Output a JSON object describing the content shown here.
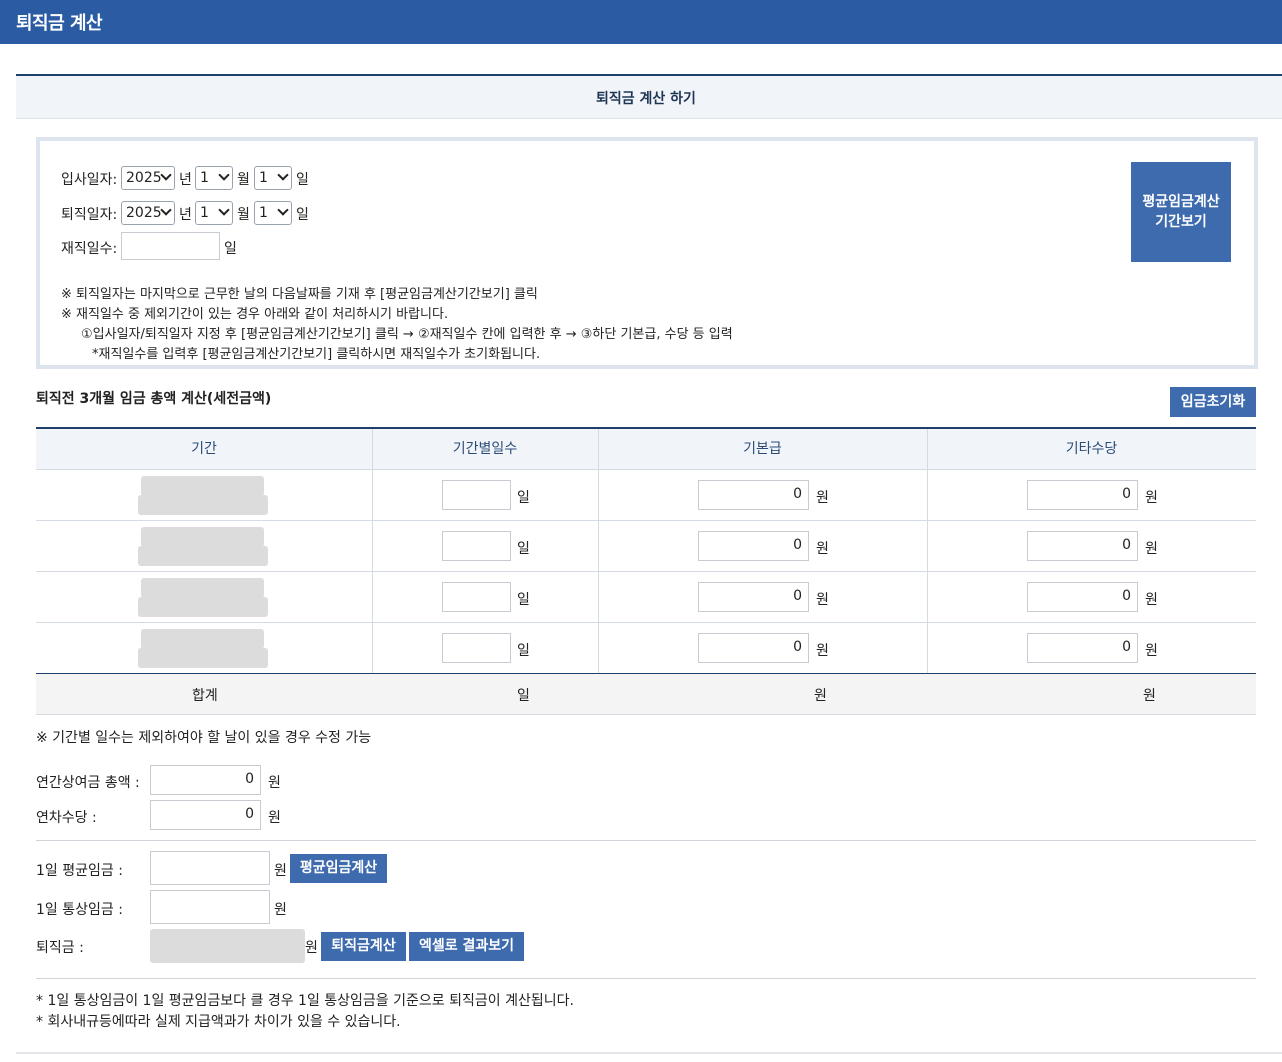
{
  "app_title": "퇴직금 계산",
  "section_title": "퇴직금 계산 하기",
  "form": {
    "entry_label": "입사일자:",
    "exit_label": "퇴직일자:",
    "days_label": "재직일수:",
    "year_value": "2025",
    "month_value": "1",
    "day_value": "1",
    "year_unit": "년",
    "month_unit": "월",
    "day_unit": "일",
    "days_unit": "일",
    "avg_period_button": "평균임금계산 기간보기",
    "notes": [
      "※ 퇴직일자는 마지막으로 근무한 날의 다음날짜를 기재 후 [평균임금계산기간보기] 클릭",
      "※ 재직일수 중 제외기간이 있는 경우 아래와 같이 처리하시기 바랍니다.",
      "①입사일자/퇴직일자 지정 후 [평균임금계산기간보기] 클릭 → ②재직일수 칸에 입력한 후 → ③하단 기본급, 수당 등 입력",
      "*재직일수를 입력후 [평균임금계산기간보기] 클릭하시면 재직일수가 초기화됩니다."
    ]
  },
  "wage_section": {
    "title": "퇴직전 3개월 임금 총액 계산(세전금액)",
    "reset_button": "임금초기화",
    "columns": [
      "기간",
      "기간별일수",
      "기본급",
      "기타수당"
    ],
    "rows": [
      {
        "base": "0",
        "other": "0"
      },
      {
        "base": "0",
        "other": "0"
      },
      {
        "base": "0",
        "other": "0"
      },
      {
        "base": "0",
        "other": "0"
      }
    ],
    "day_unit": "일",
    "won_unit": "원",
    "total_label": "합계",
    "total_days_unit": "일",
    "total_base_unit": "원",
    "total_other_unit": "원",
    "note": "※ 기간별 일수는 제외하여야 할 날이 있을 경우 수정 가능"
  },
  "bonus": {
    "bonus_label": "연간상여금 총액 :",
    "bonus_value": "0",
    "leave_label": "연차수당 :",
    "leave_value": "0",
    "unit": "원"
  },
  "result": {
    "avg_label": "1일 평균임금 :",
    "normal_label": "1일 통상임금 :",
    "severance_label": "퇴직금 :",
    "unit": "원",
    "avg_button": "평균임금계산",
    "severance_button": "퇴직금계산",
    "excel_button": "엑셀로 결과보기"
  },
  "footnotes": [
    "* 1일 통상임금이 1일 평균임금보다 클 경우 1일 통상임금을 기준으로 퇴직금이 계산됩니다.",
    "* 회사내규등에따라 실제 지급액과가 차이가 있을 수 있습니다."
  ]
}
